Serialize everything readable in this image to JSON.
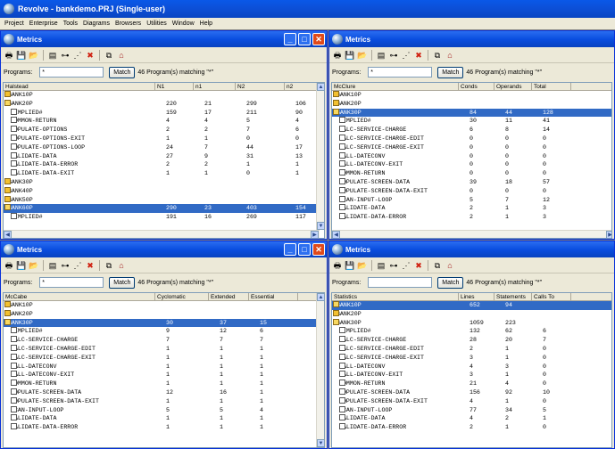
{
  "app": {
    "title": "Revolve - bankdemo.PRJ (Single-user)"
  },
  "menu": [
    "Project",
    "Enterprise",
    "Tools",
    "Diagrams",
    "Browsers",
    "Utilities",
    "Window",
    "Help"
  ],
  "panes": [
    {
      "title": "Metrics",
      "programs_label": "Programs:",
      "filter": "*",
      "match_label": "Match",
      "match_count": "46 Program(s) matching \"*\"",
      "columns": [
        "Halstead",
        "N1",
        "n1",
        "N2",
        "n2"
      ],
      "rows": [
        {
          "i": "fc",
          "n": "BBANK10P",
          "v": [
            "",
            "",
            "",
            ""
          ]
        },
        {
          "i": "fd",
          "n": "BBANK20P",
          "v": [
            "220",
            "21",
            "299",
            "106"
          ]
        },
        {
          "i": "pg",
          "n": "#IMPLIED#",
          "v": [
            "159",
            "17",
            "211",
            "90"
          ],
          "ind": 1
        },
        {
          "i": "pg",
          "n": "COMMON-RETURN",
          "v": [
            "4",
            "4",
            "5",
            "4"
          ],
          "ind": 1
        },
        {
          "i": "pg",
          "n": "POPULATE-OPTIONS",
          "v": [
            "2",
            "2",
            "7",
            "6"
          ],
          "ind": 1
        },
        {
          "i": "pg",
          "n": "POPULATE-OPTIONS-EXIT",
          "v": [
            "1",
            "1",
            "0",
            "0"
          ],
          "ind": 1
        },
        {
          "i": "pg",
          "n": "POPULATE-OPTIONS-LOOP",
          "v": [
            "24",
            "7",
            "44",
            "17"
          ],
          "ind": 1
        },
        {
          "i": "pg",
          "n": "VALIDATE-DATA",
          "v": [
            "27",
            "9",
            "31",
            "13"
          ],
          "ind": 1
        },
        {
          "i": "pg",
          "n": "VALIDATE-DATA-ERROR",
          "v": [
            "2",
            "2",
            "1",
            "1"
          ],
          "ind": 1
        },
        {
          "i": "pg",
          "n": "VALIDATE-DATA-EXIT",
          "v": [
            "1",
            "1",
            "0",
            "1"
          ],
          "ind": 1
        },
        {
          "i": "fc",
          "n": "BBANK30P",
          "v": [
            "",
            "",
            "",
            ""
          ]
        },
        {
          "i": "fc",
          "n": "BBANK40P",
          "v": [
            "",
            "",
            "",
            ""
          ]
        },
        {
          "i": "fc",
          "n": "BBANK50P",
          "v": [
            "",
            "",
            "",
            ""
          ]
        },
        {
          "i": "fd",
          "n": "BBANK60P",
          "v": [
            "290",
            "23",
            "403",
            "154"
          ],
          "sel": 1
        },
        {
          "i": "pg",
          "n": "#IMPLIED#",
          "v": [
            "191",
            "16",
            "269",
            "117"
          ],
          "ind": 1
        }
      ]
    },
    {
      "title": "Metrics",
      "programs_label": "Programs:",
      "filter": "*",
      "match_label": "Match",
      "match_count": "46 Program(s) matching \"*\"",
      "columns": [
        "McClure",
        "Conds",
        "Operands",
        "Total"
      ],
      "rows": [
        {
          "i": "fc",
          "n": "BBANK10P",
          "v": [
            "",
            "",
            ""
          ]
        },
        {
          "i": "fc",
          "n": "BBANK20P",
          "v": [
            "",
            "",
            ""
          ]
        },
        {
          "i": "fd",
          "n": "BBANK30P",
          "v": [
            "84",
            "44",
            "128"
          ],
          "sel": 1
        },
        {
          "i": "pg",
          "n": "#IMPLIED#",
          "v": [
            "30",
            "11",
            "41"
          ],
          "ind": 1
        },
        {
          "i": "pg",
          "n": "CALC-SERVICE-CHARGE",
          "v": [
            "6",
            "8",
            "14"
          ],
          "ind": 1
        },
        {
          "i": "pg",
          "n": "CALC-SERVICE-CHARGE-EDIT",
          "v": [
            "0",
            "0",
            "0"
          ],
          "ind": 1
        },
        {
          "i": "pg",
          "n": "CALC-SERVICE-CHARGE-EXIT",
          "v": [
            "0",
            "0",
            "0"
          ],
          "ind": 1
        },
        {
          "i": "pg",
          "n": "CALL-DATECONV",
          "v": [
            "0",
            "0",
            "0"
          ],
          "ind": 1
        },
        {
          "i": "pg",
          "n": "CALL-DATECONV-EXIT",
          "v": [
            "0",
            "0",
            "0"
          ],
          "ind": 1
        },
        {
          "i": "pg",
          "n": "COMMON-RETURN",
          "v": [
            "0",
            "0",
            "0"
          ],
          "ind": 1
        },
        {
          "i": "pg",
          "n": "POPULATE-SCREEN-DATA",
          "v": [
            "39",
            "18",
            "57"
          ],
          "ind": 1
        },
        {
          "i": "pg",
          "n": "POPULATE-SCREEN-DATA-EXIT",
          "v": [
            "0",
            "0",
            "0"
          ],
          "ind": 1
        },
        {
          "i": "pg",
          "n": "SCAN-INPUT-LOOP",
          "v": [
            "5",
            "7",
            "12"
          ],
          "ind": 1
        },
        {
          "i": "pg",
          "n": "VALIDATE-DATA",
          "v": [
            "2",
            "1",
            "3"
          ],
          "ind": 1
        },
        {
          "i": "pg",
          "n": "VALIDATE-DATA-ERROR",
          "v": [
            "2",
            "1",
            "3"
          ],
          "ind": 1
        }
      ]
    },
    {
      "title": "Metrics",
      "programs_label": "Programs:",
      "filter": "*",
      "match_label": "Match",
      "match_count": "46 Program(s) matching \"*\"",
      "columns": [
        "McCabe",
        "Cyclomatic",
        "Extended",
        "Essential"
      ],
      "rows": [
        {
          "i": "fc",
          "n": "BBANK10P",
          "v": [
            "",
            "",
            ""
          ]
        },
        {
          "i": "fc",
          "n": "BBANK20P",
          "v": [
            "",
            "",
            ""
          ]
        },
        {
          "i": "fd",
          "n": "BBANK30P",
          "v": [
            "30",
            "37",
            "15"
          ],
          "sel": 1
        },
        {
          "i": "pg",
          "n": "#IMPLIED#",
          "v": [
            "9",
            "12",
            "6"
          ],
          "ind": 1
        },
        {
          "i": "pg",
          "n": "CALC-SERVICE-CHARGE",
          "v": [
            "7",
            "7",
            "7"
          ],
          "ind": 1
        },
        {
          "i": "pg",
          "n": "CALC-SERVICE-CHARGE-EDIT",
          "v": [
            "1",
            "1",
            "1"
          ],
          "ind": 1
        },
        {
          "i": "pg",
          "n": "CALC-SERVICE-CHARGE-EXIT",
          "v": [
            "1",
            "1",
            "1"
          ],
          "ind": 1
        },
        {
          "i": "pg",
          "n": "CALL-DATECONV",
          "v": [
            "1",
            "1",
            "1"
          ],
          "ind": 1
        },
        {
          "i": "pg",
          "n": "CALL-DATECONV-EXIT",
          "v": [
            "1",
            "1",
            "1"
          ],
          "ind": 1
        },
        {
          "i": "pg",
          "n": "COMMON-RETURN",
          "v": [
            "1",
            "1",
            "1"
          ],
          "ind": 1
        },
        {
          "i": "pg",
          "n": "POPULATE-SCREEN-DATA",
          "v": [
            "12",
            "16",
            "1"
          ],
          "ind": 1
        },
        {
          "i": "pg",
          "n": "POPULATE-SCREEN-DATA-EXIT",
          "v": [
            "1",
            "1",
            "1"
          ],
          "ind": 1
        },
        {
          "i": "pg",
          "n": "SCAN-INPUT-LOOP",
          "v": [
            "5",
            "5",
            "4"
          ],
          "ind": 1
        },
        {
          "i": "pg",
          "n": "VALIDATE-DATA",
          "v": [
            "1",
            "1",
            "1"
          ],
          "ind": 1
        },
        {
          "i": "pg",
          "n": "VALIDATE-DATA-ERROR",
          "v": [
            "1",
            "1",
            "1"
          ],
          "ind": 1
        }
      ]
    },
    {
      "title": "Metrics",
      "programs_label": "Programs:",
      "filter": "",
      "match_label": "Match",
      "match_count": "46 Program(s) matching \"*\"",
      "columns": [
        "Statistics",
        "Lines",
        "Statements",
        "Calls To"
      ],
      "rows": [
        {
          "i": "fd",
          "n": "BBANK10P",
          "v": [
            "652",
            "94",
            ""
          ],
          "sel": 1
        },
        {
          "i": "fc",
          "n": "BBANK20P",
          "v": [
            "",
            "",
            ""
          ]
        },
        {
          "i": "fd",
          "n": "BBANK30P",
          "v": [
            "1059",
            "223",
            ""
          ]
        },
        {
          "i": "pg",
          "n": "#IMPLIED#",
          "v": [
            "132",
            "62",
            "6"
          ],
          "ind": 1
        },
        {
          "i": "pg",
          "n": "CALC-SERVICE-CHARGE",
          "v": [
            "28",
            "20",
            "7"
          ],
          "ind": 1
        },
        {
          "i": "pg",
          "n": "CALC-SERVICE-CHARGE-EDIT",
          "v": [
            "2",
            "1",
            "0"
          ],
          "ind": 1
        },
        {
          "i": "pg",
          "n": "CALC-SERVICE-CHARGE-EXIT",
          "v": [
            "3",
            "1",
            "0"
          ],
          "ind": 1
        },
        {
          "i": "pg",
          "n": "CALL-DATECONV",
          "v": [
            "4",
            "3",
            "0"
          ],
          "ind": 1
        },
        {
          "i": "pg",
          "n": "CALL-DATECONV-EXIT",
          "v": [
            "3",
            "1",
            "0"
          ],
          "ind": 1
        },
        {
          "i": "pg",
          "n": "COMMON-RETURN",
          "v": [
            "21",
            "4",
            "0"
          ],
          "ind": 1
        },
        {
          "i": "pg",
          "n": "POPULATE-SCREEN-DATA",
          "v": [
            "156",
            "92",
            "10"
          ],
          "ind": 1
        },
        {
          "i": "pg",
          "n": "POPULATE-SCREEN-DATA-EXIT",
          "v": [
            "4",
            "1",
            "0"
          ],
          "ind": 1
        },
        {
          "i": "pg",
          "n": "SCAN-INPUT-LOOP",
          "v": [
            "77",
            "34",
            "5"
          ],
          "ind": 1
        },
        {
          "i": "pg",
          "n": "VALIDATE-DATA",
          "v": [
            "4",
            "2",
            "1"
          ],
          "ind": 1
        },
        {
          "i": "pg",
          "n": "VALIDATE-DATA-ERROR",
          "v": [
            "2",
            "1",
            "0"
          ],
          "ind": 1
        }
      ]
    }
  ],
  "colors": {
    "selection": "#316ac5",
    "title_blue": "#0a4ee0"
  }
}
